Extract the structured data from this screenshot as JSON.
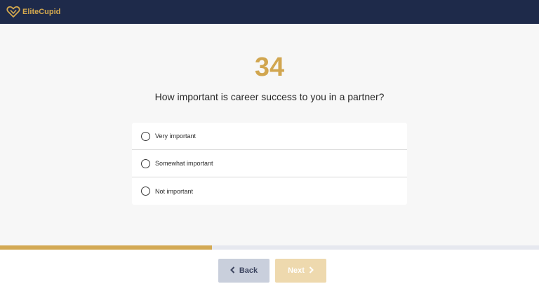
{
  "header": {
    "brand": "EliteCupid",
    "logo_icon": "heart-icon",
    "colors": {
      "bar": "#1e2a4a",
      "accent": "#d4a94f"
    }
  },
  "question": {
    "number": "34",
    "text": "How important is career success to you in a partner?"
  },
  "options": [
    {
      "label": "Very important",
      "selected": false
    },
    {
      "label": "Somewhat important",
      "selected": false
    },
    {
      "label": "Not important",
      "selected": false
    }
  ],
  "progress": {
    "fraction": 0.393
  },
  "footer": {
    "back_label": "Back",
    "next_label": "Next",
    "back_icon": "chevron-left-icon",
    "next_icon": "chevron-right-icon"
  }
}
